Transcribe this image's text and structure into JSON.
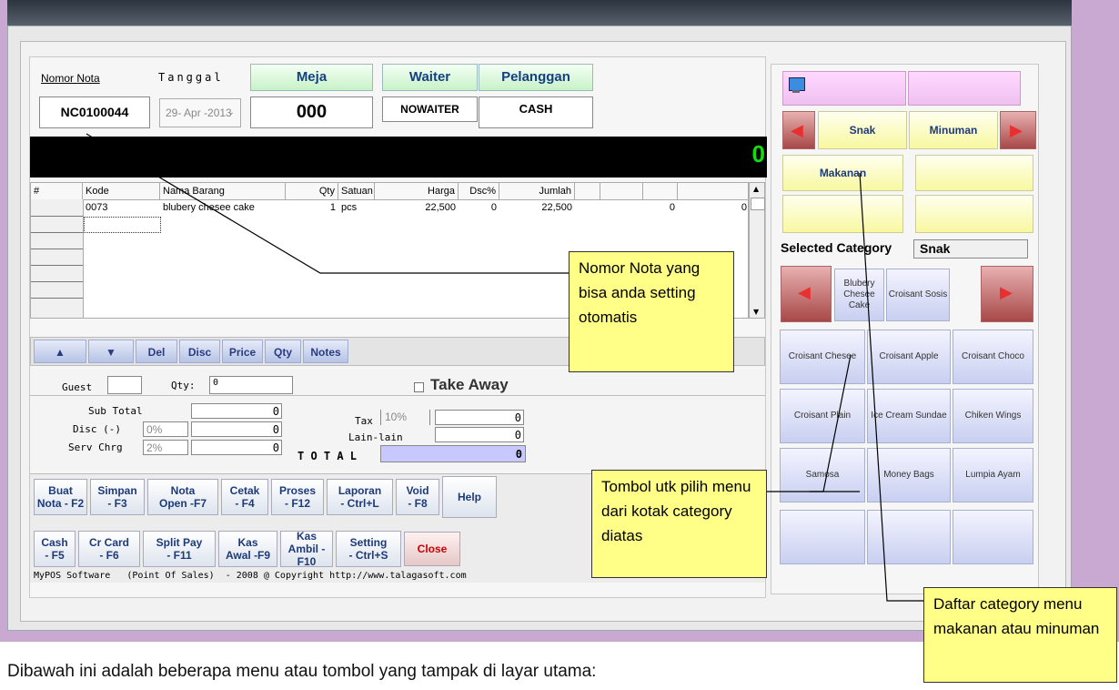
{
  "header": {
    "nomor_nota_label": "Nomor Nota",
    "tanggal_label": "Tanggal",
    "nomor_nota_value": "NC0100044",
    "tanggal_value": "29- Apr -2013",
    "meja_button": "Meja",
    "waiter_button": "Waiter",
    "pelanggan_button": "Pelanggan",
    "meja_value": "000",
    "waiter_value": "NOWAITER",
    "pelanggan_value": "CASH",
    "display_total": "0"
  },
  "grid": {
    "columns": [
      "#",
      "Kode",
      "Nama Barang",
      "Qty",
      "Satuan",
      "Harga",
      "Dsc%",
      "Jumlah",
      "",
      "",
      "",
      ""
    ],
    "rows": [
      {
        "kode": "0073",
        "nama": "blubery chesee cake",
        "qty": "1",
        "satuan": "pcs",
        "harga": "22,500",
        "dsc": "0",
        "jumlah": "22,500",
        "c1": "0",
        "c2": "0"
      }
    ]
  },
  "nav_buttons": {
    "up": "▲",
    "down": "▼",
    "del": "Del",
    "disc": "Disc",
    "price": "Price",
    "qty": "Qty",
    "notes": "Notes"
  },
  "guest_row": {
    "guest_label": "Guest",
    "qty_label": "Qty:",
    "qty_value": "0",
    "take_away_label": "Take Away"
  },
  "totals": {
    "sub_total_label": "Sub Total",
    "sub_total_value": "0",
    "disc_label": "Disc (-)",
    "disc_percent": "0%",
    "disc_value": "0",
    "serv_label": "Serv Chrg",
    "serv_percent": "2%",
    "serv_value": "0",
    "tax_label": "Tax",
    "tax_percent": "10%",
    "tax_value": "0",
    "lain_label": "Lain-lain",
    "lain_value": "0",
    "total_label": "T O T A L",
    "total_value": "0"
  },
  "function_buttons": {
    "row1": [
      {
        "l1": "Buat",
        "l2": "Nota - F2"
      },
      {
        "l1": "Simpan",
        "l2": "- F3"
      },
      {
        "l1": "Nota",
        "l2": "Open -F7"
      },
      {
        "l1": "Cetak",
        "l2": "- F4"
      },
      {
        "l1": "Proses",
        "l2": "- F12"
      },
      {
        "l1": "Laporan",
        "l2": "- Ctrl+L"
      },
      {
        "l1": "Void",
        "l2": "- F8"
      }
    ],
    "help": "Help",
    "row2": [
      {
        "l1": "Cash",
        "l2": "- F5"
      },
      {
        "l1": "Cr Card",
        "l2": "- F6"
      },
      {
        "l1": "Split Pay",
        "l2": "- F11"
      },
      {
        "l1": "Kas",
        "l2": "Awal -F9"
      },
      {
        "l1": "Kas",
        "l2": "Ambil -",
        "l3": "F10"
      },
      {
        "l1": "Setting",
        "l2": "- Ctrl+S"
      }
    ],
    "close": "Close"
  },
  "status_bar": "MyPOS Software   (Point Of Sales)  - 2008 @ Copyright http://www.talagasoft.com",
  "right_panel": {
    "categories": [
      "Snak",
      "Minuman",
      "Makanan"
    ],
    "selected_category_label": "Selected Category",
    "selected_category_value": "Snak",
    "menu_top": [
      "Blubery Chesee Cake",
      "Croisant Sosis"
    ],
    "menu_items": [
      "Croisant Chesee",
      "Croisant Apple",
      "Croisant Choco",
      "Croisant Plain",
      "Ice Cream Sundae",
      "Chiken Wings",
      "Samosa",
      "Money Bags",
      "Lumpia Ayam"
    ]
  },
  "callouts": {
    "nomor_nota": "Nomor Nota yang bisa anda setting otomatis",
    "tombol": "Tombol utk pilih menu dari kotak category diatas",
    "daftar": "Daftar category menu makanan atau minuman"
  },
  "caption": "Dibawah ini adalah beberapa menu atau tombol yang tampak di layar utama:"
}
